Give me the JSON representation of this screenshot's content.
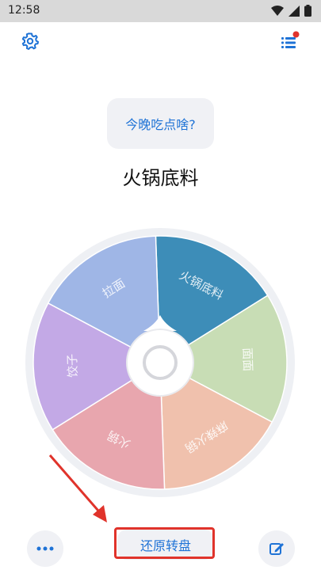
{
  "status_bar": {
    "time": "12:58"
  },
  "toolbar": {
    "settings_icon": "gear-icon",
    "menu_icon": "list-icon",
    "has_notification": true
  },
  "prompt": {
    "question": "今晚吃点啥?"
  },
  "result": {
    "selected": "火锅底料"
  },
  "wheel": {
    "slices": [
      {
        "label": "火锅底料",
        "color": "#3d8db8"
      },
      {
        "label": "面面",
        "color": "#c8ddb5"
      },
      {
        "label": "麻辣火锅",
        "color": "#f0c1ad"
      },
      {
        "label": "火锅",
        "color": "#e8a6ae"
      },
      {
        "label": "饺子",
        "color": "#c3a9e6"
      },
      {
        "label": "拉面",
        "color": "#9fb6e6"
      }
    ],
    "ring_color": "#eef0f4"
  },
  "bottom_bar": {
    "more_icon": "more-icon",
    "restore_label": "还原转盘",
    "edit_icon": "edit-icon"
  },
  "colors": {
    "accent": "#1f73d6",
    "highlight": "#e0332b"
  }
}
